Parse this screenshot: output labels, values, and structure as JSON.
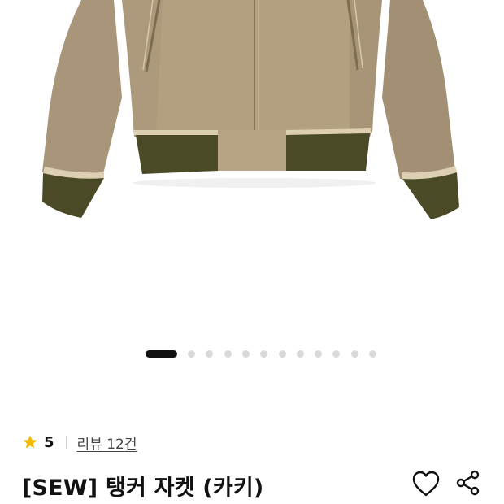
{
  "product": {
    "image_subject": "jacket-photo",
    "rating_score": "5",
    "review_link": "리뷰 12건",
    "title": "[SEW] 탱커 자켓 (카키)"
  },
  "carousel": {
    "total_slides": 12,
    "active_index": 0
  },
  "icons": {
    "rating": "star-icon",
    "wishlist": "heart-icon",
    "share": "share-icon"
  },
  "colors": {
    "star": "#f5b800",
    "jacket_body": "#b09c7c",
    "rib_knit": "#4a4a26",
    "piping": "#d9ccb0"
  }
}
